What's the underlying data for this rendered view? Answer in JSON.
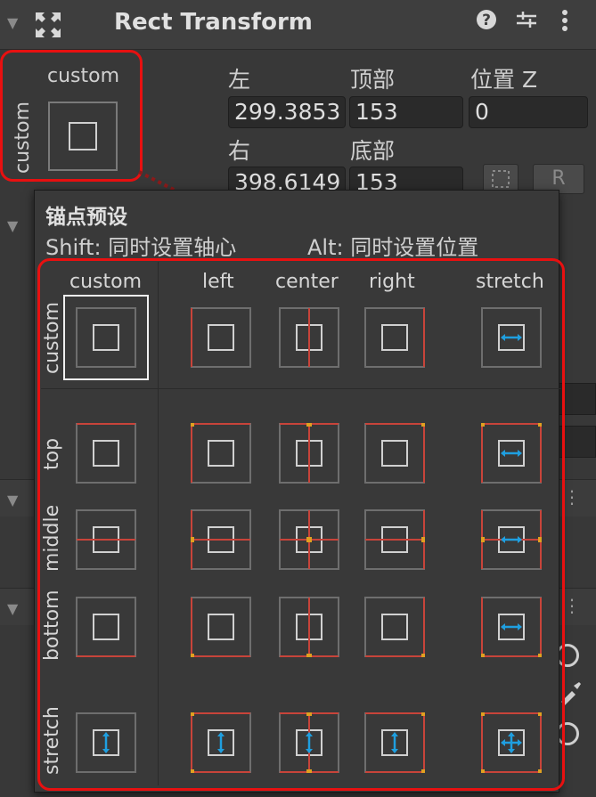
{
  "header": {
    "title": "Rect Transform",
    "foldout_icon": "triangle-down-icon",
    "component_icon": "rect-transform-icon",
    "help_icon": "help-icon",
    "presets_icon": "sliders-icon",
    "menu_icon": "kebab-menu-icon"
  },
  "anchor_button": {
    "horizontal_caption": "custom",
    "vertical_caption": "custom"
  },
  "fields": {
    "left_label": "左",
    "top_label": "顶部",
    "posz_label": "位置 Z",
    "left_value": "299.3853",
    "top_value": "153",
    "posz_value": "0",
    "right_label": "右",
    "bottom_label": "底部",
    "right_value": "398.6149",
    "bottom_value": "153",
    "blueprint_button": "blueprint-icon",
    "raw_button_label": "R"
  },
  "popup": {
    "title": "锚点预设",
    "shift_hint": "Shift:  同时设置轴心",
    "alt_hint": "Alt:  同时设置位置",
    "column_headers": [
      "custom",
      "left",
      "center",
      "right",
      "stretch"
    ],
    "row_headers": [
      "custom",
      "top",
      "middle",
      "bottom",
      "stretch"
    ],
    "selected_preset": "custom"
  },
  "colors": {
    "highlight_red": "#e81010",
    "anchor_line": "#c8443a",
    "anchor_dot": "#e0a020",
    "stretch_arrow": "#1f9fe0",
    "panel_bg": "#383838"
  }
}
